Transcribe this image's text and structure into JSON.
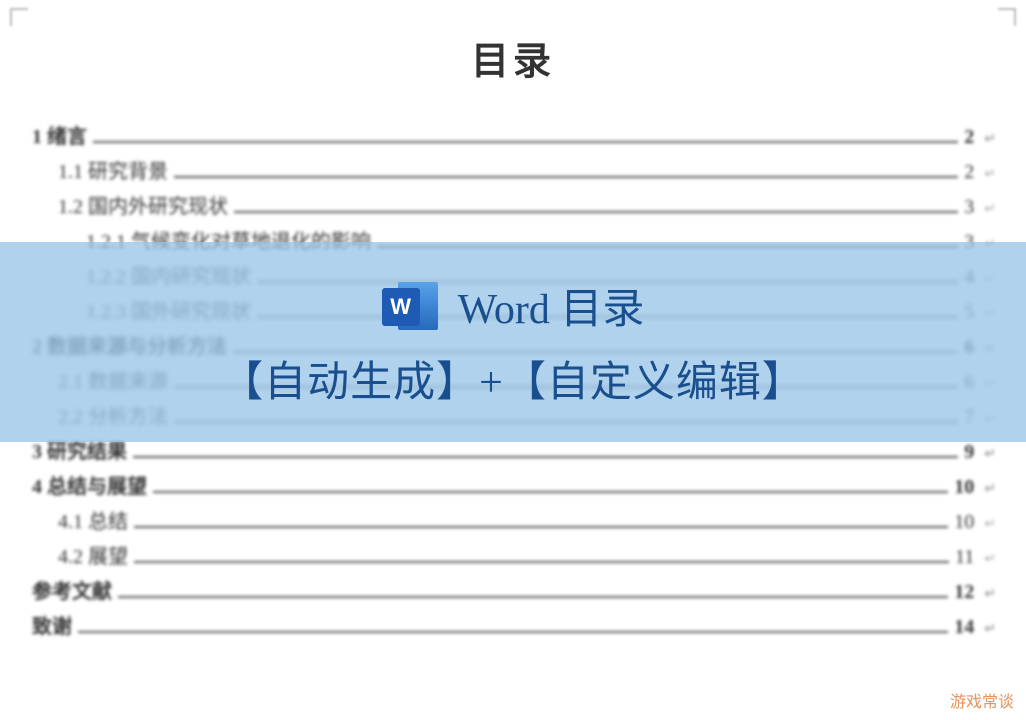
{
  "title": "目录",
  "overlay": {
    "heading": "Word 目录",
    "subtitle": "【自动生成】+【自定义编辑】",
    "icon_letter": "W"
  },
  "watermark": "游戏常谈",
  "toc": [
    {
      "level": 1,
      "label": "1 绪言",
      "page": "2"
    },
    {
      "level": 2,
      "label": "1.1 研究背景",
      "page": "2"
    },
    {
      "level": 2,
      "label": "1.2 国内外研究现状",
      "page": "3"
    },
    {
      "level": 3,
      "label": "1.2.1 气候变化对草地退化的影响",
      "page": "3"
    },
    {
      "level": 3,
      "label": "1.2.2 国内研究现状",
      "page": "4"
    },
    {
      "level": 3,
      "label": "1.2.3 国外研究现状",
      "page": "5"
    },
    {
      "level": 1,
      "label": "2 数据来源与分析方法",
      "page": "6"
    },
    {
      "level": 2,
      "label": "2.1 数据来源",
      "page": "6"
    },
    {
      "level": 2,
      "label": "2.2 分析方法",
      "page": "7"
    },
    {
      "level": 1,
      "label": "3 研究结果",
      "page": "9"
    },
    {
      "level": 1,
      "label": "4 总结与展望",
      "page": "10"
    },
    {
      "level": 2,
      "label": "4.1 总结",
      "page": "10"
    },
    {
      "level": 2,
      "label": "4.2 展望",
      "page": "11"
    },
    {
      "level": 1,
      "label": "参考文献",
      "page": "12"
    },
    {
      "level": 1,
      "label": "致谢",
      "page": "14"
    }
  ]
}
